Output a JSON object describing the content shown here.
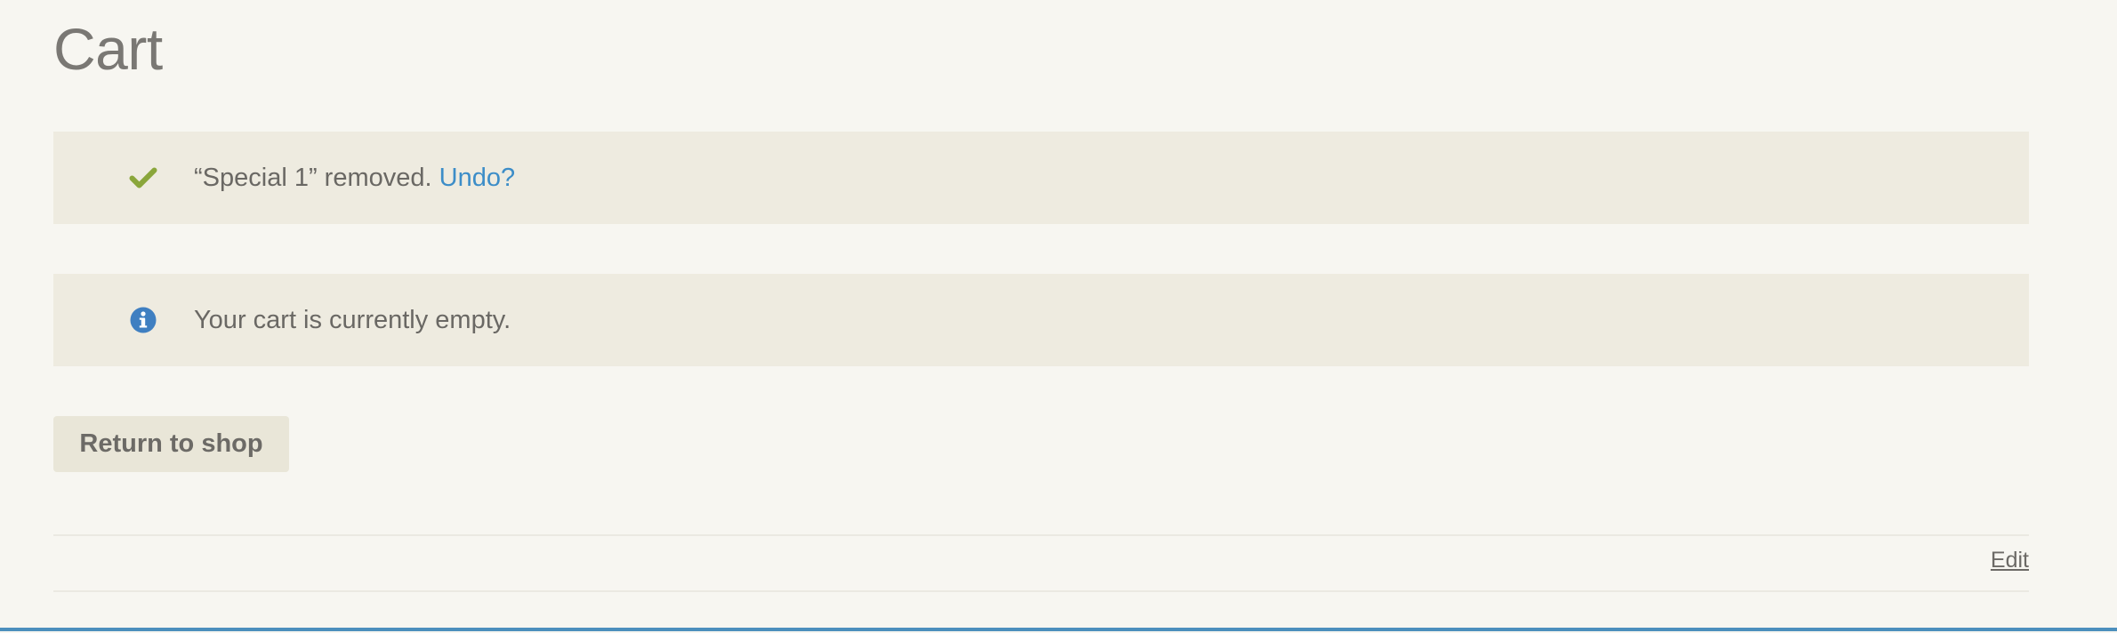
{
  "page": {
    "title": "Cart"
  },
  "notices": {
    "removed": {
      "icon": "check-icon",
      "text": "“Special 1” removed.",
      "undo_label": "Undo?",
      "icon_color": "#8aa63b",
      "link_color": "#3c8dc8"
    },
    "empty": {
      "icon": "info-icon",
      "text": "Your cart is currently empty.",
      "icon_color": "#3f7fc1"
    }
  },
  "actions": {
    "return_label": "Return to shop",
    "edit_label": "Edit"
  },
  "colors": {
    "background": "#f7f6f1",
    "notice_background": "#eeebe0",
    "button_background": "#e9e6d8",
    "accent_bar": "#4c8fbd"
  }
}
